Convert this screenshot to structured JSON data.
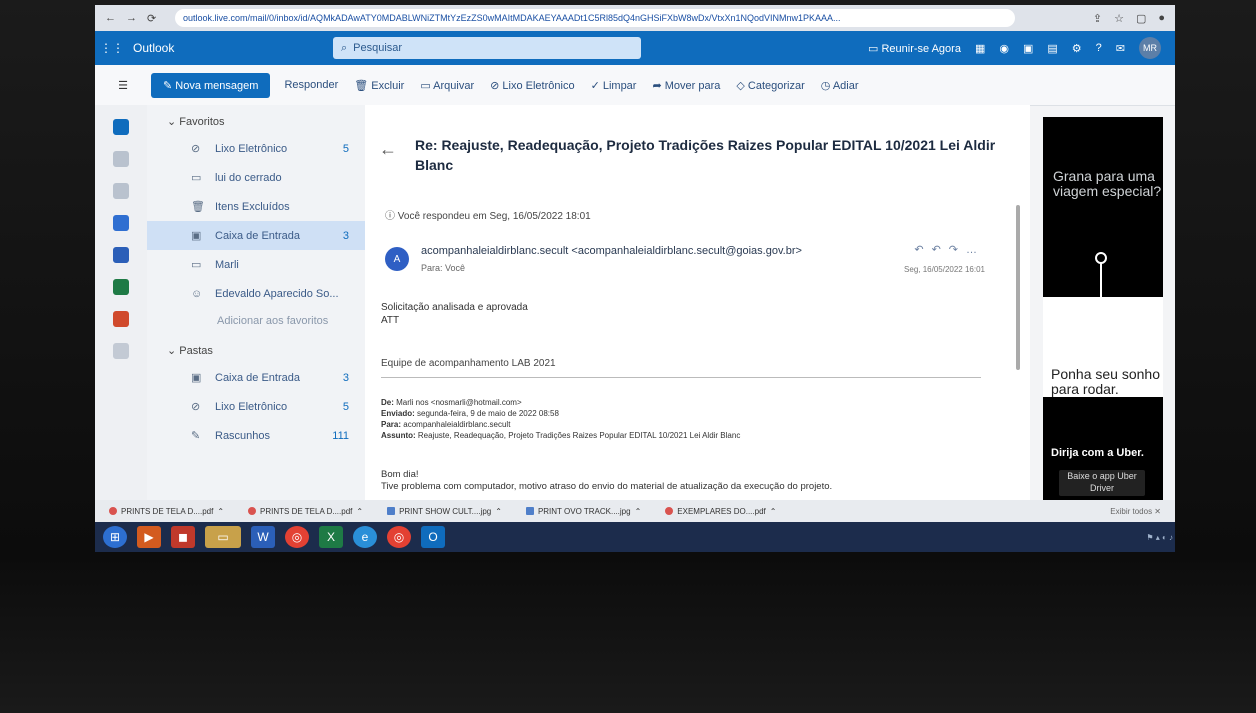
{
  "browser": {
    "url": "outlook.live.com/mail/0/inbox/id/AQMkADAwATY0MDABLWNiZTMtYzEzZS0wMAItMDAKAEYAAADt1C5Rl85dQ4nGHSiFXbW8wDx/VtxXn1NQodVINMnw1PKAAA...",
    "back_icon": "arrow-left-icon",
    "forward_icon": "arrow-right-icon",
    "reload_icon": "reload-icon"
  },
  "outlook": {
    "brand": "Outlook",
    "search_placeholder": "Pesquisar",
    "meet_now": "Reunir-se Agora",
    "avatar": "MR"
  },
  "ribbon": {
    "new_message": "Nova mensagem",
    "items": [
      "Responder",
      "Excluir",
      "Arquivar",
      "Lixo Eletrônico",
      "Limpar",
      "Mover para",
      "Categorizar",
      "Adiar"
    ]
  },
  "folders": {
    "favorites_label": "Favoritos",
    "favorites": [
      {
        "icon": "junk-icon",
        "label": "Lixo Eletrônico",
        "count": "5"
      },
      {
        "icon": "folder-icon",
        "label": "lui do cerrado",
        "count": ""
      },
      {
        "icon": "trash-icon",
        "label": "Itens Excluídos",
        "count": ""
      },
      {
        "icon": "inbox-icon",
        "label": "Caixa de Entrada",
        "count": "3"
      },
      {
        "icon": "folder-icon",
        "label": "Marli",
        "count": ""
      },
      {
        "icon": "person-icon",
        "label": "Edevaldo Aparecido So...",
        "count": ""
      }
    ],
    "add_favorite": "Adicionar aos favoritos",
    "folders_label": "Pastas",
    "folders": [
      {
        "icon": "inbox-icon",
        "label": "Caixa de Entrada",
        "count": "3"
      },
      {
        "icon": "junk-icon",
        "label": "Lixo Eletrônico",
        "count": "5"
      },
      {
        "icon": "draft-icon",
        "label": "Rascunhos",
        "count": "111"
      }
    ]
  },
  "email": {
    "subject": "Re: Reajuste, Readequação, Projeto Tradições Raizes Popular EDITAL 10/2021 Lei Aldir Blanc",
    "replied_notice": "Você respondeu em Seg, 16/05/2022 18:01",
    "avatar_letter": "A",
    "from": "acompanhaleialdirblanc.secult <acompanhaleialdirblanc.secult@goias.gov.br>",
    "to": "Para: Você",
    "date": "Seg, 16/05/2022 16:01",
    "body_line1": "Solicitação analisada e aprovada",
    "body_line2": "ATT",
    "team": "Equipe de acompanhamento LAB 2021",
    "hdr_from_label": "De:",
    "hdr_from": "Marli nos <nosmarli@hotmail.com>",
    "hdr_sent_label": "Enviado:",
    "hdr_sent": "segunda-feira, 9 de maio de 2022 08:58",
    "hdr_to_label": "Para:",
    "hdr_to": "acompanhaleialdirblanc.secult",
    "hdr_subject_label": "Assunto:",
    "hdr_subject": "Reajuste, Readequação, Projeto Tradições Raizes Popular EDITAL 10/2021 Lei Aldir Blanc",
    "greeting": "Bom dia!",
    "body_more": "Tive problema com computador, motivo atraso do envio do material de atualização da execução do projeto."
  },
  "ad": {
    "top": "Grana para uma viagem especial?",
    "bottom": "Ponha seu sonho para rodar.",
    "cta_title": "Dirija com a Uber.",
    "cta_button": "Baixe o app Uber Driver"
  },
  "downloads": [
    {
      "name": "PRINTS DE TELA D....pdf",
      "type": "pdf"
    },
    {
      "name": "PRINTS DE TELA D....pdf",
      "type": "pdf"
    },
    {
      "name": "PRINT SHOW CULT....jpg",
      "type": "img"
    },
    {
      "name": "PRINT OVO TRACK....jpg",
      "type": "img"
    },
    {
      "name": "EXEMPLARES DO....pdf",
      "type": "pdf"
    }
  ],
  "downloads_show_all": "Exibir todos",
  "colors": {
    "accent": "#0f6cbd",
    "selected": "#cfe0f5",
    "taskbar": "#1c2c4c"
  }
}
